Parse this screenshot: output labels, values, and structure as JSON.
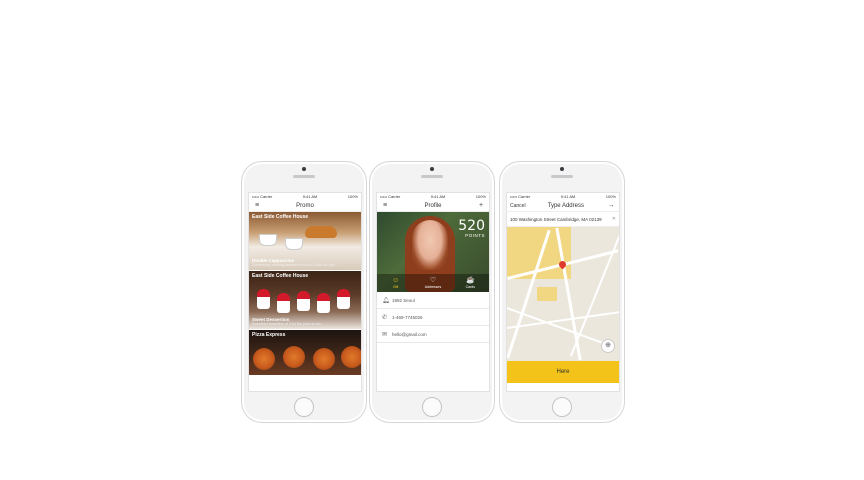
{
  "status_bar": {
    "carrier": "••••• Carrier",
    "time": "9:41 AM",
    "battery": "100%"
  },
  "promo_screen": {
    "title": "Promo",
    "cards": [
      {
        "heading": "East Side Coffee House",
        "name": "Double Cappuccino",
        "desc": "Come every morning between 9 AM to 11 AM and get ..."
      },
      {
        "heading": "East Side Coffee House",
        "name": "Sweet Dessertion",
        "desc": "Sweetest Dessertion of 2 for the price of one..."
      },
      {
        "heading": "Pizza Express",
        "name": "",
        "desc": ""
      }
    ]
  },
  "profile_screen": {
    "title": "Profile",
    "points_value": "520",
    "points_label": "POINTS",
    "tabs": [
      "Gift",
      "Addresses",
      "Cards"
    ],
    "info": [
      {
        "icon": "bell-icon",
        "text": "1992 Seoul"
      },
      {
        "icon": "phone-icon",
        "text": "1-469-7745026"
      },
      {
        "icon": "mail-icon",
        "text": "hello@gmail.com"
      }
    ]
  },
  "address_screen": {
    "cancel": "Cancel",
    "title": "Type Address",
    "address": "100 Washington Street Cambridge, MA 02139",
    "button": "Here",
    "colors": {
      "accent": "#f3c31a"
    }
  }
}
